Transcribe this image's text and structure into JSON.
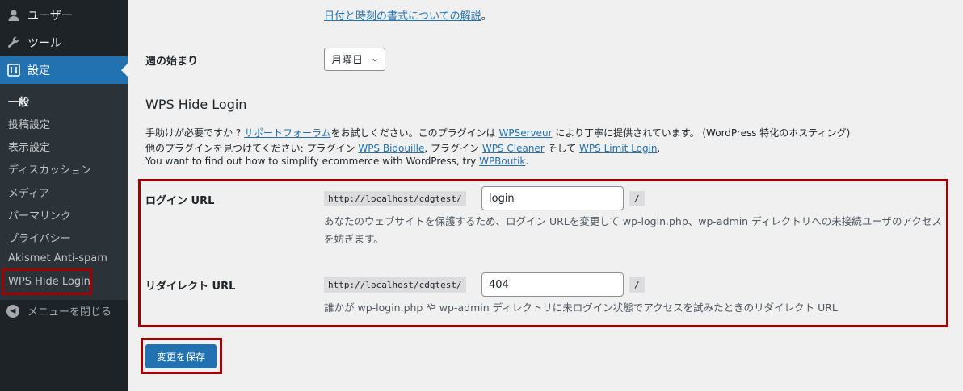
{
  "sidebar": {
    "menu": [
      {
        "label": "ユーザー",
        "icon": "user-icon"
      },
      {
        "label": "ツール",
        "icon": "wrench-icon"
      },
      {
        "label": "設定",
        "icon": "settings-icon"
      }
    ],
    "submenu": [
      {
        "label": "一般"
      },
      {
        "label": "投稿設定"
      },
      {
        "label": "表示設定"
      },
      {
        "label": "ディスカッション"
      },
      {
        "label": "メディア"
      },
      {
        "label": "パーマリンク"
      },
      {
        "label": "プライバシー"
      },
      {
        "label": "Akismet Anti-spam"
      },
      {
        "label": "WPS Hide Login"
      }
    ],
    "collapse_label": "メニューを閉じる"
  },
  "content": {
    "datetime_doc_link": "日付と時刻の書式についての解説",
    "datetime_doc_suffix": "。",
    "week_start": {
      "label": "週の始まり",
      "value": "月曜日"
    },
    "section_title": "WPS Hide Login",
    "desc": {
      "line1_a": "手助けが必要ですか ? ",
      "line1_link1": "サポートフォーラム",
      "line1_b": "をお試しください。このプラグインは ",
      "line1_link2": "WPServeur",
      "line1_c": " により丁寧に提供されています。 (WordPress 特化のホスティング)",
      "line2_a": "他のプラグインを見つけてください: プラグイン ",
      "line2_link1": "WPS Bidouille",
      "line2_b": ", プラグイン ",
      "line2_link2": "WPS Cleaner",
      "line2_c": " そして ",
      "line2_link3": "WPS Limit Login",
      "line2_d": ".",
      "line3_a": "You want to find out how to simplify ecommerce with WordPress, try ",
      "line3_link": "WPBoutik",
      "line3_b": "."
    },
    "login_url": {
      "label": "ログイン URL",
      "prefix": "http://localhost/cdgtest/",
      "value": "login",
      "suffix": "/",
      "help": "あなたのウェブサイトを保護するため、ログイン URLを変更して wp-login.php、wp-admin ディレクトリへの未接続ユーザのアクセスを妨ぎます。"
    },
    "redirect_url": {
      "label": "リダイレクト URL",
      "prefix": "http://localhost/cdgtest/",
      "value": "404",
      "suffix": "/",
      "help": "誰かが wp-login.php や wp-admin ディレクトリに未ログイン状態でアクセスを試みたときのリダイレクト URL"
    },
    "save_label": "変更を保存"
  }
}
